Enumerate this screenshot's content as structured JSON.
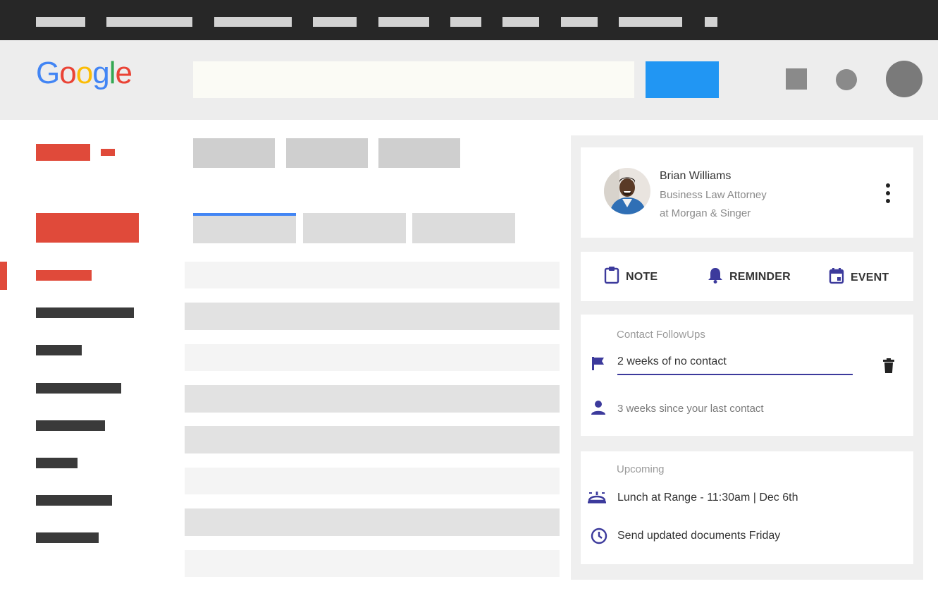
{
  "header": {
    "logo": {
      "letters": [
        "G",
        "o",
        "o",
        "g",
        "l",
        "e"
      ],
      "colors": [
        "#4285F4",
        "#EA4335",
        "#FBBC05",
        "#4285F4",
        "#34A853",
        "#EA4335"
      ]
    },
    "search": {
      "value": "",
      "placeholder": ""
    }
  },
  "contact": {
    "name": "Brian Williams",
    "title_line1": "Business Law Attorney",
    "title_line2": "at Morgan & Singer"
  },
  "actions": {
    "note": "NOTE",
    "reminder": "REMINDER",
    "event": "EVENT"
  },
  "followups": {
    "title": "Contact FollowUps",
    "items": [
      {
        "text": "2 weeks of no contact",
        "icon": "flag-icon"
      },
      {
        "text": "3 weeks since your last contact",
        "icon": "person-icon"
      }
    ]
  },
  "upcoming": {
    "title": "Upcoming",
    "items": [
      {
        "text": "Lunch at Range - 11:30am | Dec 6th",
        "icon": "meal-icon"
      },
      {
        "text": "Send updated documents Friday",
        "icon": "clock-icon"
      }
    ]
  },
  "colors": {
    "accent_purple": "#3c3a9c",
    "search_button": "#2196f3",
    "sidebar_red": "#e04a3a",
    "active_tab_blue": "#4285f4"
  }
}
